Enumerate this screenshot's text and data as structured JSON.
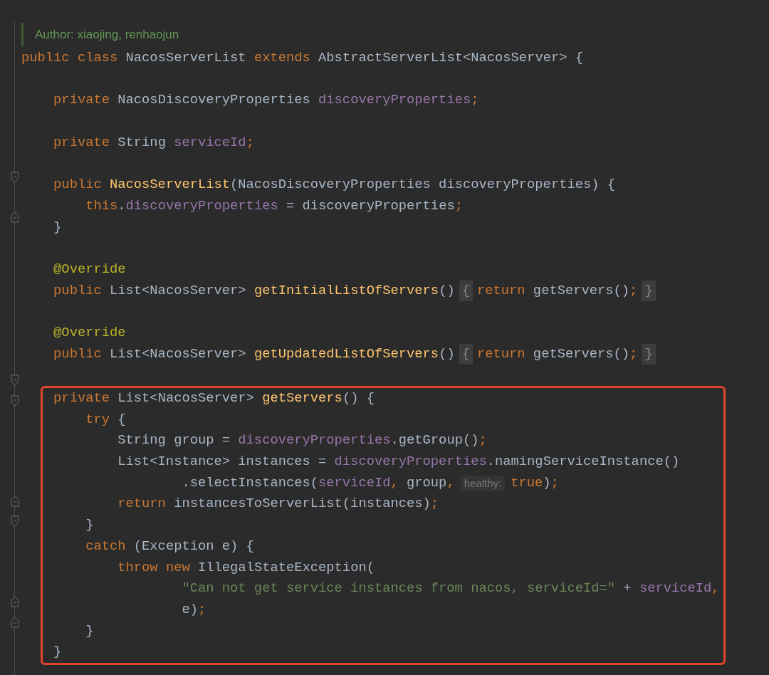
{
  "doc_comment": {
    "text": "Author: xiaojing, renhaojun"
  },
  "sections": [
    {
      "boxed": false,
      "lines": [
        {
          "kind": "code",
          "tokens": [
            {
              "text": "public",
              "kind": "keyword"
            },
            {
              "text": " class",
              "kind": "keyword"
            },
            {
              "text": " NacosServerList ",
              "kind": "plain"
            },
            {
              "text": "extends",
              "kind": "keyword"
            },
            {
              "text": " AbstractServerList<NacosServer> {",
              "kind": "plain"
            }
          ]
        },
        {
          "kind": "blank"
        },
        {
          "kind": "code",
          "tokens": [
            {
              "text": "    private",
              "kind": "keyword"
            },
            {
              "text": " NacosDiscoveryProperties ",
              "kind": "plain"
            },
            {
              "text": "discoveryProperties",
              "kind": "field"
            },
            {
              "text": ";",
              "kind": "keyword"
            }
          ]
        },
        {
          "kind": "blank"
        },
        {
          "kind": "code",
          "tokens": [
            {
              "text": "    private",
              "kind": "keyword"
            },
            {
              "text": " String ",
              "kind": "plain"
            },
            {
              "text": "serviceId",
              "kind": "field"
            },
            {
              "text": ";",
              "kind": "keyword"
            }
          ]
        },
        {
          "kind": "blank"
        },
        {
          "kind": "fold_start",
          "tokens": [
            {
              "text": "    public",
              "kind": "keyword"
            },
            {
              "text": " NacosServerList",
              "kind": "method"
            },
            {
              "text": "(NacosDiscoveryProperties discoveryProperties) {",
              "kind": "plain"
            }
          ]
        },
        {
          "kind": "code",
          "tokens": [
            {
              "text": "        this",
              "kind": "keyword"
            },
            {
              "text": ".",
              "kind": "plain"
            },
            {
              "text": "discoveryProperties",
              "kind": "field"
            },
            {
              "text": " = discoveryProperties",
              "kind": "plain"
            },
            {
              "text": ";",
              "kind": "keyword"
            }
          ]
        },
        {
          "kind": "fold_end",
          "tokens": [
            {
              "text": "    }",
              "kind": "plain"
            }
          ]
        },
        {
          "kind": "blank"
        },
        {
          "kind": "code",
          "tokens": [
            {
              "text": "    @Override",
              "kind": "annotation"
            }
          ]
        },
        {
          "kind": "folded",
          "tokens": [
            {
              "text": "    public",
              "kind": "keyword"
            },
            {
              "text": " List<NacosServer> ",
              "kind": "plain"
            },
            {
              "text": "getInitialListOfServers",
              "kind": "method"
            },
            {
              "text": "()",
              "kind": "plain"
            },
            {
              "text": "{",
              "kind": "folded"
            },
            {
              "text": "return",
              "kind": "keyword"
            },
            {
              "text": " getServers()",
              "kind": "plain"
            },
            {
              "text": ";",
              "kind": "keyword"
            },
            {
              "text": "}",
              "kind": "folded"
            }
          ]
        },
        {
          "kind": "blank"
        },
        {
          "kind": "code",
          "tokens": [
            {
              "text": "    @Override",
              "kind": "annotation"
            }
          ]
        },
        {
          "kind": "folded",
          "tokens": [
            {
              "text": "    public",
              "kind": "keyword"
            },
            {
              "text": " List<NacosServer> ",
              "kind": "plain"
            },
            {
              "text": "getUpdatedListOfServers",
              "kind": "method"
            },
            {
              "text": "()",
              "kind": "plain"
            },
            {
              "text": "{",
              "kind": "folded"
            },
            {
              "text": "return",
              "kind": "keyword"
            },
            {
              "text": " getServers()",
              "kind": "plain"
            },
            {
              "text": ";",
              "kind": "keyword"
            },
            {
              "text": "}",
              "kind": "folded"
            }
          ]
        },
        {
          "kind": "blank"
        }
      ]
    },
    {
      "boxed": true,
      "lines": [
        {
          "kind": "fold_start",
          "tokens": [
            {
              "text": "    private",
              "kind": "keyword"
            },
            {
              "text": " List<NacosServer> ",
              "kind": "plain"
            },
            {
              "text": "getServers",
              "kind": "method"
            },
            {
              "text": "() {",
              "kind": "plain"
            }
          ]
        },
        {
          "kind": "fold_start",
          "tokens": [
            {
              "text": "        try",
              "kind": "keyword"
            },
            {
              "text": " {",
              "kind": "plain"
            }
          ]
        },
        {
          "kind": "code",
          "tokens": [
            {
              "text": "            String group = ",
              "kind": "plain"
            },
            {
              "text": "discoveryProperties",
              "kind": "field"
            },
            {
              "text": ".getGroup()",
              "kind": "plain"
            },
            {
              "text": ";",
              "kind": "keyword"
            }
          ]
        },
        {
          "kind": "code",
          "tokens": [
            {
              "text": "            List<Instance> instances = ",
              "kind": "plain"
            },
            {
              "text": "discoveryProperties",
              "kind": "field"
            },
            {
              "text": ".namingServiceInstance()",
              "kind": "plain"
            }
          ]
        },
        {
          "kind": "code",
          "tokens": [
            {
              "text": "                    .selectInstances(",
              "kind": "plain"
            },
            {
              "text": "serviceId",
              "kind": "field"
            },
            {
              "text": ",",
              "kind": "keyword"
            },
            {
              "text": " group",
              "kind": "plain"
            },
            {
              "text": ",",
              "kind": "keyword"
            },
            {
              "text": "healthy:",
              "kind": "hint"
            },
            {
              "text": "true",
              "kind": "keyword"
            },
            {
              "text": ")",
              "kind": "plain"
            },
            {
              "text": ";",
              "kind": "keyword"
            }
          ]
        },
        {
          "kind": "code",
          "tokens": [
            {
              "text": "            return",
              "kind": "keyword"
            },
            {
              "text": " instancesToServerList(instances)",
              "kind": "plain"
            },
            {
              "text": ";",
              "kind": "keyword"
            }
          ]
        },
        {
          "kind": "fold_end",
          "tokens": [
            {
              "text": "        }",
              "kind": "plain"
            }
          ]
        },
        {
          "kind": "fold_start",
          "tokens": [
            {
              "text": "        catch",
              "kind": "keyword"
            },
            {
              "text": " (Exception e) {",
              "kind": "plain"
            }
          ]
        },
        {
          "kind": "code",
          "tokens": [
            {
              "text": "            throw",
              "kind": "keyword"
            },
            {
              "text": " new",
              "kind": "keyword"
            },
            {
              "text": " IllegalStateException(",
              "kind": "plain"
            }
          ]
        },
        {
          "kind": "code",
          "tokens": [
            {
              "text": "                    \"Can not get service instances from nacos, serviceId=\"",
              "kind": "string"
            },
            {
              "text": " + ",
              "kind": "plain"
            },
            {
              "text": "serviceId",
              "kind": "field"
            },
            {
              "text": ",",
              "kind": "keyword"
            }
          ]
        },
        {
          "kind": "code",
          "tokens": [
            {
              "text": "                    e)",
              "kind": "plain"
            },
            {
              "text": ";",
              "kind": "keyword"
            }
          ]
        },
        {
          "kind": "fold_end",
          "tokens": [
            {
              "text": "        }",
              "kind": "plain"
            }
          ]
        },
        {
          "kind": "fold_end",
          "tokens": [
            {
              "text": "    }",
              "kind": "plain"
            }
          ]
        }
      ]
    }
  ]
}
